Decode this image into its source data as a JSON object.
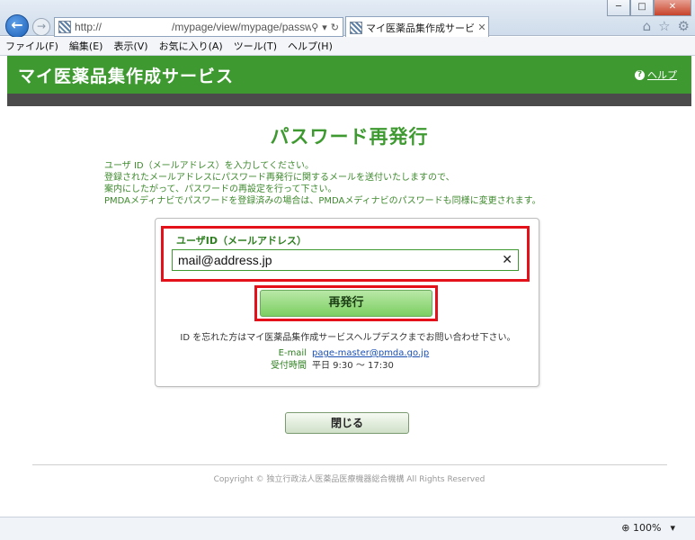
{
  "browser": {
    "address_prefix": "http://",
    "address_path": "/mypage/view/mypage/passwc",
    "tab_title": "マイ医薬品集作成サービ...",
    "window_buttons": {
      "minimize": "─",
      "maximize": "□",
      "close": "✕"
    },
    "menu": [
      "ファイル(F)",
      "編集(E)",
      "表示(V)",
      "お気に入り(A)",
      "ツール(T)",
      "ヘルプ(H)"
    ],
    "zoom": "100%"
  },
  "header": {
    "site_title": "マイ医薬品集作成サービス",
    "help_label": "ヘルプ"
  },
  "page": {
    "title": "パスワード再発行",
    "instructions": [
      "ユーザ ID（メールアドレス）を入力してください。",
      "登録されたメールアドレスにパスワード再発行に関するメールを送付いたしますので、",
      "案内にしたがって、パスワードの再設定を行って下さい。",
      "PMDAメディナビでパスワードを登録済みの場合は、PMDAメディナビのパスワードも同様に変更されます。"
    ],
    "form": {
      "field_label": "ユーザID（メールアドレス）",
      "field_value": "mail@address.jp",
      "reissue_button": "再発行"
    },
    "forgot_text": "ID を忘れた方はマイ医薬品集作成サービスヘルプデスクまでお問い合わせ下さい。",
    "contact": {
      "email_label": "E-mail",
      "email": "page-master@pmda.go.jp",
      "hours_label": "受付時間",
      "hours": "平日 9:30 〜 17:30"
    },
    "close_button": "閉じる",
    "copyright": "Copyright © 独立行政法人医薬品医療機器総合機構 All Rights Reserved"
  },
  "colors": {
    "brand_green": "#3e9a30",
    "highlight_red": "#e4111b",
    "link_blue": "#1a4fb4"
  }
}
